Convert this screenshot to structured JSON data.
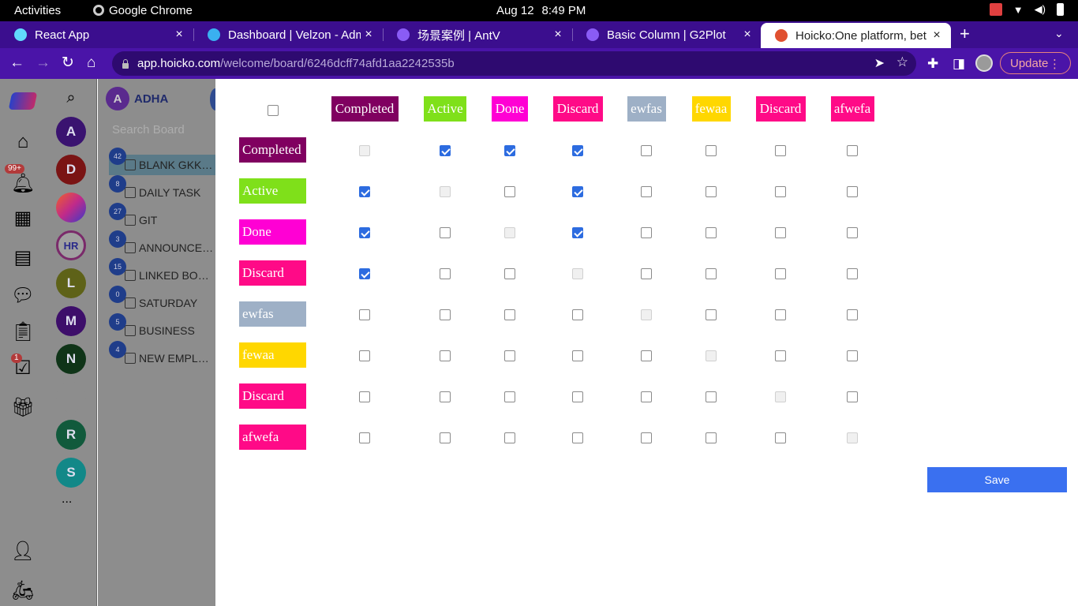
{
  "system_bar": {
    "activities": "Activities",
    "app": "Google Chrome",
    "date": "Aug 12",
    "time": "8:49 PM"
  },
  "tabs": [
    {
      "label": "React App",
      "icon": "react-icon",
      "color": "#61dafb"
    },
    {
      "label": "Dashboard | Velzon - Adm",
      "icon": "velzon-icon",
      "color": "#3ab0f0"
    },
    {
      "label": "场景案例 | AntV",
      "icon": "antv-icon",
      "color": "#8a5cf5"
    },
    {
      "label": "Basic Column | G2Plot",
      "icon": "antv-icon",
      "color": "#8a5cf5"
    },
    {
      "label": "Hoicko:One platform, bet",
      "icon": "hoicko-icon",
      "color": "#e05030",
      "active": true
    }
  ],
  "address": {
    "host": "app.hoicko.com",
    "path": "/welcome/board/6246dcff74afd1aa2242535b"
  },
  "update_label": "Update",
  "rail": {
    "notification_badge": "99+",
    "task_badge": "1"
  },
  "workspaces": [
    {
      "letter": "A",
      "color": "#3a1370"
    },
    {
      "letter": "D",
      "color": "#7a1414"
    },
    {
      "letter": "",
      "color": "#c03050"
    },
    {
      "letter": "HR",
      "color": "#a0a0a0"
    },
    {
      "letter": "L",
      "color": "#5e6218"
    },
    {
      "letter": "M",
      "color": "#3d0e6a"
    },
    {
      "letter": "N",
      "color": "#0f3418"
    },
    {
      "letter": "",
      "color": "#8d8d8d"
    },
    {
      "letter": "R",
      "color": "#115a3c"
    },
    {
      "letter": "S",
      "color": "#128888"
    }
  ],
  "more_label": "...",
  "workspace": {
    "initial": "A",
    "name": "ADHA",
    "search_placeholder": "Search Board"
  },
  "boards": [
    {
      "count": "42",
      "name": "BLANK GKKGKGKG",
      "selected": true
    },
    {
      "count": "8",
      "name": "DAILY TASK"
    },
    {
      "count": "27",
      "name": "GIT"
    },
    {
      "count": "3",
      "name": "ANNOUNCEMENTS"
    },
    {
      "count": "15",
      "name": "LINKED BOARD"
    },
    {
      "count": "0",
      "name": "SATURDAY"
    },
    {
      "count": "5",
      "name": "BUSINESS"
    },
    {
      "count": "4",
      "name": "NEW EMPLOYEES"
    }
  ],
  "statuses": [
    {
      "label": "Completed",
      "color": "#800060"
    },
    {
      "label": "Active",
      "color": "#7fe01a"
    },
    {
      "label": "Done",
      "color": "#ff00d4"
    },
    {
      "label": "Discard",
      "color": "#ff0a87"
    },
    {
      "label": "ewfas",
      "color": "#9eb0c6"
    },
    {
      "label": "fewaa",
      "color": "#ffd700"
    },
    {
      "label": "Discard",
      "color": "#ff0a87"
    },
    {
      "label": "afwefa",
      "color": "#ff0a87"
    }
  ],
  "matrix": [
    [
      0,
      1,
      1,
      1,
      0,
      0,
      0,
      0
    ],
    [
      1,
      0,
      0,
      1,
      0,
      0,
      0,
      0
    ],
    [
      1,
      0,
      0,
      1,
      0,
      0,
      0,
      0
    ],
    [
      1,
      0,
      0,
      0,
      0,
      0,
      0,
      0
    ],
    [
      0,
      0,
      0,
      0,
      0,
      0,
      0,
      0
    ],
    [
      0,
      0,
      0,
      0,
      0,
      0,
      0,
      0
    ],
    [
      0,
      0,
      0,
      0,
      0,
      0,
      0,
      0
    ],
    [
      0,
      0,
      0,
      0,
      0,
      0,
      0,
      0
    ]
  ],
  "save_label": "Save"
}
